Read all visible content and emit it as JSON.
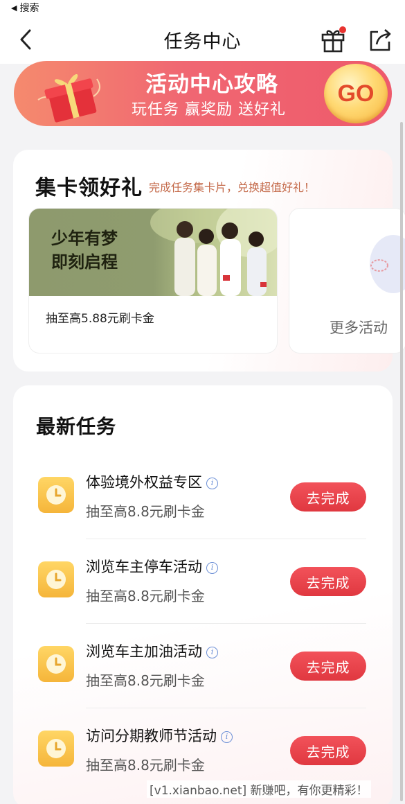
{
  "status_bar": {
    "back_label": "搜索"
  },
  "nav": {
    "title": "任务中心",
    "gift_icon": "gift-icon",
    "share_icon": "share-icon",
    "badge_color": "#e8322f"
  },
  "banner": {
    "title": "活动中心攻略",
    "subtitle": "玩任务 赢奖励 送好礼",
    "go_label": "GO"
  },
  "collect_cards": {
    "title": "集卡领好礼",
    "subtitle": "完成任务集卡片，兑换超值好礼！",
    "promo": {
      "headline_line1": "少年有梦",
      "headline_line2": "即刻启程",
      "reward": "抽至高5.88元刷卡金"
    },
    "more_label": "更多活动"
  },
  "latest_tasks": {
    "title": "最新任务",
    "button_color": "#e8404a",
    "tasks": [
      {
        "name": "体验境外权益专区",
        "reward": "抽至高8.8元刷卡金",
        "button": "去完成"
      },
      {
        "name": "浏览车主停车活动",
        "reward": "抽至高8.8元刷卡金",
        "button": "去完成"
      },
      {
        "name": "浏览车主加油活动",
        "reward": "抽至高8.8元刷卡金",
        "button": "去完成"
      },
      {
        "name": "访问分期教师节活动",
        "reward": "抽至高8.8元刷卡金",
        "button": "去完成"
      }
    ]
  },
  "watermark": "[v1.xianbao.net] 新赚吧，有你更精彩！"
}
